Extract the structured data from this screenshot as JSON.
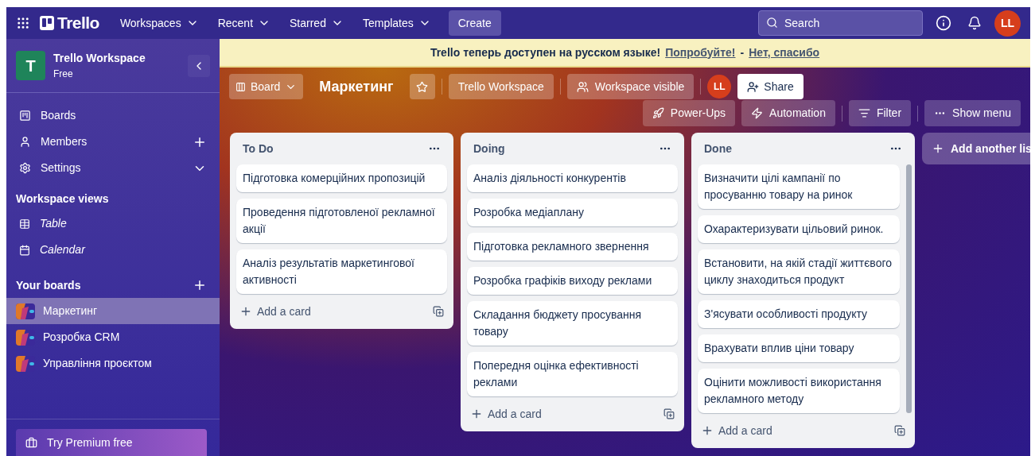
{
  "nav": {
    "app_name": "Trello",
    "menus": [
      {
        "label": "Workspaces"
      },
      {
        "label": "Recent"
      },
      {
        "label": "Starred"
      },
      {
        "label": "Templates"
      }
    ],
    "create": "Create",
    "search": {
      "placeholder": "Search"
    },
    "avatar": "LL"
  },
  "sidebar": {
    "workspace": {
      "initial": "T",
      "name": "Trello Workspace",
      "plan": "Free"
    },
    "items": [
      {
        "label": "Boards",
        "kind": "link"
      },
      {
        "label": "Members",
        "kind": "add"
      },
      {
        "label": "Settings",
        "kind": "expand"
      }
    ],
    "views_title": "Workspace views",
    "views": [
      {
        "label": "Table"
      },
      {
        "label": "Calendar"
      }
    ],
    "boards_title": "Your boards",
    "boards": [
      {
        "name": "Маркетинг",
        "selected": true
      },
      {
        "name": "Розробка CRM",
        "selected": false
      },
      {
        "name": "Управління проєктом",
        "selected": false
      }
    ],
    "premium": "Try Premium free"
  },
  "banner": {
    "text": "Trello теперь доступен на русском языке!",
    "link": "Попробуйте!",
    "separator": "-",
    "dismiss": "Нет, спасибо"
  },
  "board": {
    "view": "Board",
    "title": "Маркетинг",
    "workspace": "Trello Workspace",
    "visibility": "Workspace visible",
    "member_avatar": "LL",
    "share": "Share",
    "tools": [
      {
        "label": "Power-Ups"
      },
      {
        "label": "Automation"
      },
      {
        "label": "Filter"
      },
      {
        "label": "Show menu"
      }
    ]
  },
  "lists": [
    {
      "title": "To Do",
      "cards": [
        "Підготовка комерційних пропозицій",
        "Проведення підготовленої рекламної акції",
        "Аналіз результатів маркетингової активності"
      ],
      "add_card": "Add a card"
    },
    {
      "title": "Doing",
      "cards": [
        "Аналіз діяльності конкурентів",
        "Розробка медіаплану",
        "Підготовка рекламного звернення",
        "Розробка графіків виходу реклами",
        "Складання бюджету просування товару",
        "Попередня оцінка ефективності реклами"
      ],
      "add_card": "Add a card"
    },
    {
      "title": "Done",
      "cards": [
        "Визначити цілі кампанії по просуванню товару на ринок",
        "Охарактеризувати цільовий ринок.",
        "Встановити, на якій стадії життєвого циклу знаходиться продукт",
        "З'ясувати особливості продукту",
        "Врахувати вплив ціни товару",
        "Оцінити можливості використання рекламного методу"
      ],
      "add_card": "Add a card"
    }
  ],
  "add_list": "Add another lis"
}
